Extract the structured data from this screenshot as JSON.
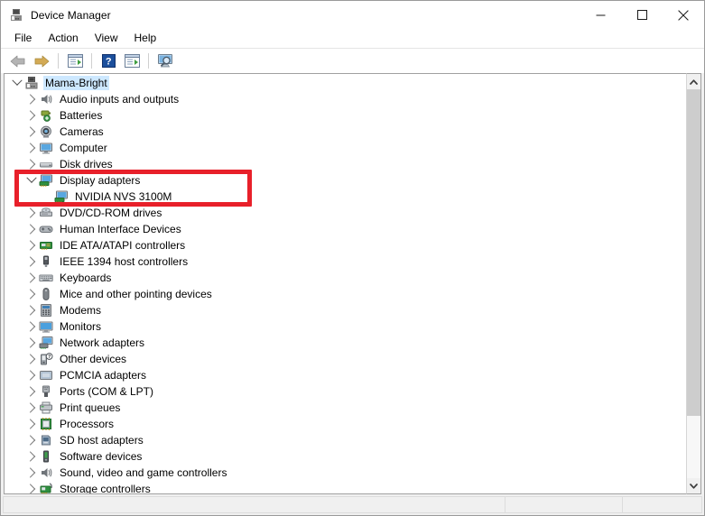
{
  "window": {
    "title": "Device Manager",
    "icon": "device-manager-icon",
    "controls": {
      "minimize": "minimize-icon",
      "maximize": "maximize-icon",
      "close": "close-icon"
    }
  },
  "menubar": {
    "items": [
      {
        "label": "File"
      },
      {
        "label": "Action"
      },
      {
        "label": "View"
      },
      {
        "label": "Help"
      }
    ]
  },
  "toolbar": {
    "buttons": [
      {
        "name": "back-button",
        "icon": "back-arrow-icon"
      },
      {
        "name": "forward-button",
        "icon": "forward-arrow-icon"
      },
      {
        "name": "properties-button",
        "icon": "properties-icon"
      },
      {
        "name": "help-button",
        "icon": "help-question-icon"
      },
      {
        "name": "update-driver-button",
        "icon": "update-driver-icon"
      },
      {
        "name": "scan-hardware-button",
        "icon": "scan-hardware-icon"
      }
    ]
  },
  "tree": {
    "root": {
      "label": "Mama-Bright",
      "icon": "computer-icon",
      "expanded": true,
      "selected": true
    },
    "items": [
      {
        "label": "Audio inputs and outputs",
        "icon": "speaker-icon",
        "expanded": false
      },
      {
        "label": "Batteries",
        "icon": "battery-icon",
        "expanded": false
      },
      {
        "label": "Cameras",
        "icon": "camera-icon",
        "expanded": false
      },
      {
        "label": "Computer",
        "icon": "monitor-icon",
        "expanded": false
      },
      {
        "label": "Disk drives",
        "icon": "disk-drive-icon",
        "expanded": false
      },
      {
        "label": "Display adapters",
        "icon": "display-adapter-icon",
        "expanded": true,
        "highlighted": true
      },
      {
        "label": "NVIDIA NVS 3100M",
        "icon": "display-adapter-icon",
        "child": true,
        "highlighted": true
      },
      {
        "label": "DVD/CD-ROM drives",
        "icon": "optical-drive-icon",
        "expanded": false
      },
      {
        "label": "Human Interface Devices",
        "icon": "hid-icon",
        "expanded": false
      },
      {
        "label": "IDE ATA/ATAPI controllers",
        "icon": "ide-controller-icon",
        "expanded": false
      },
      {
        "label": "IEEE 1394 host controllers",
        "icon": "firewire-icon",
        "expanded": false
      },
      {
        "label": "Keyboards",
        "icon": "keyboard-icon",
        "expanded": false
      },
      {
        "label": "Mice and other pointing devices",
        "icon": "mouse-icon",
        "expanded": false
      },
      {
        "label": "Modems",
        "icon": "modem-icon",
        "expanded": false
      },
      {
        "label": "Monitors",
        "icon": "monitor-icon",
        "expanded": false
      },
      {
        "label": "Network adapters",
        "icon": "network-adapter-icon",
        "expanded": false
      },
      {
        "label": "Other devices",
        "icon": "other-device-icon",
        "expanded": false
      },
      {
        "label": "PCMCIA adapters",
        "icon": "pcmcia-icon",
        "expanded": false
      },
      {
        "label": "Ports (COM & LPT)",
        "icon": "port-icon",
        "expanded": false
      },
      {
        "label": "Print queues",
        "icon": "printer-icon",
        "expanded": false
      },
      {
        "label": "Processors",
        "icon": "processor-icon",
        "expanded": false
      },
      {
        "label": "SD host adapters",
        "icon": "sd-host-icon",
        "expanded": false
      },
      {
        "label": "Software devices",
        "icon": "software-device-icon",
        "expanded": false
      },
      {
        "label": "Sound, video and game controllers",
        "icon": "speaker-icon",
        "expanded": false
      },
      {
        "label": "Storage controllers",
        "icon": "storage-controller-icon",
        "expanded": false
      }
    ]
  },
  "scrollbar": {
    "up_arrow": "scroll-up-icon",
    "down_arrow": "scroll-down-icon",
    "thumb_percent": 84
  },
  "statusbar": {
    "pane1": "",
    "pane2": "",
    "pane3": ""
  },
  "annotation": {
    "color": "#e8202a",
    "target": "Display adapters"
  }
}
